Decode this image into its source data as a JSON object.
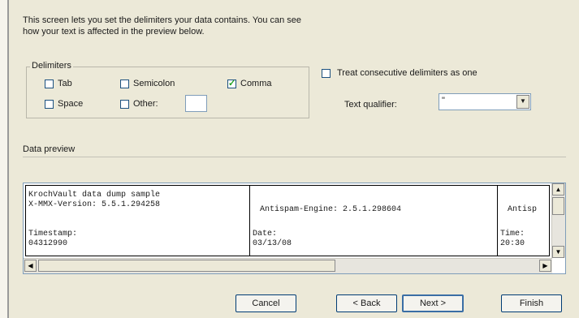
{
  "description": {
    "line1": "This screen lets you set the delimiters your data contains.  You can see",
    "line2": "how your text is affected in the preview below."
  },
  "delimiters": {
    "legend": "Delimiters",
    "tab": {
      "label": "Tab",
      "checked": false
    },
    "semicolon": {
      "label": "Semicolon",
      "checked": false
    },
    "comma": {
      "label": "Comma",
      "checked": true
    },
    "space": {
      "label": "Space",
      "checked": false
    },
    "other": {
      "label": "Other:",
      "checked": false,
      "value": ""
    }
  },
  "options": {
    "consecutive": {
      "label": "Treat consecutive delimiters as one",
      "checked": false
    },
    "qualifier": {
      "label": "Text qualifier:",
      "value": "\""
    }
  },
  "preview": {
    "legend": "Data preview",
    "columns": [
      {
        "row1a": "KrochVault data dump sample",
        "row1b": "X-MMX-Version: 5.5.1.294258",
        "row2a": "Timestamp:",
        "row2b": "04312990"
      },
      {
        "row1a": "",
        "row1b": "Antispam-Engine: 2.5.1.298604",
        "row2a": "Date:",
        "row2b": "03/13/08"
      },
      {
        "row1a": "",
        "row1b": "Antisp",
        "row2a": "Time:",
        "row2b": "20:30"
      }
    ]
  },
  "buttons": {
    "cancel": "Cancel",
    "back": "< Back",
    "next": "Next >",
    "finish": "Finish"
  }
}
